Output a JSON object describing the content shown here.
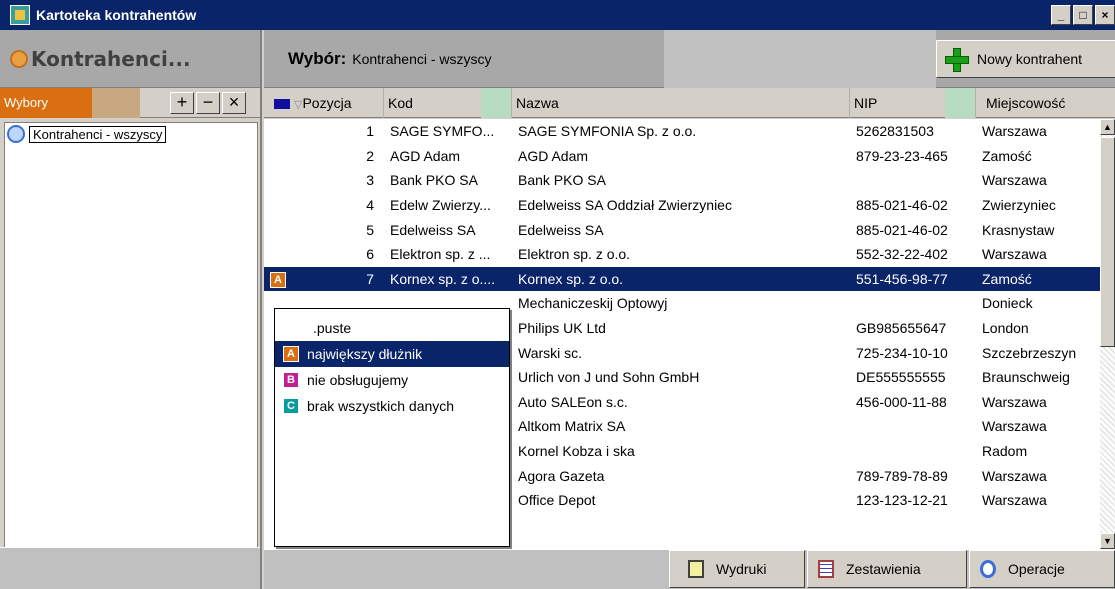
{
  "window": {
    "title": "Kartoteka kontrahentów"
  },
  "left": {
    "header": "Kontrahenci...",
    "wybory_tab": "Wybory",
    "tree_items": [
      "Kontrahenci - wszyscy"
    ]
  },
  "right": {
    "wybor_label": "Wybór:",
    "wybor_value": "Kontrahenci - wszyscy",
    "new_button": "Nowy kontrahent"
  },
  "columns": {
    "pozycja": "Pozycja",
    "kod": "Kod",
    "nazwa": "Nazwa",
    "nip": "NIP",
    "miejscowosc": "Miejscowość"
  },
  "rows": [
    {
      "mark": "",
      "poz": "1",
      "kod": "SAGE SYMFO...",
      "nazwa": "SAGE SYMFONIA Sp. z o.o.",
      "nip": "5262831503",
      "miasto": "Warszawa"
    },
    {
      "mark": "",
      "poz": "2",
      "kod": "AGD Adam",
      "nazwa": "AGD Adam",
      "nip": "879-23-23-465",
      "miasto": "Zamość"
    },
    {
      "mark": "",
      "poz": "3",
      "kod": "Bank PKO SA",
      "nazwa": "Bank PKO SA",
      "nip": "",
      "miasto": "Warszawa"
    },
    {
      "mark": "",
      "poz": "4",
      "kod": "Edelw Zwierzy...",
      "nazwa": "Edelweiss SA Oddział Zwierzyniec",
      "nip": "885-021-46-02",
      "miasto": "Zwierzyniec"
    },
    {
      "mark": "",
      "poz": "5",
      "kod": "Edelweiss SA",
      "nazwa": "Edelweiss SA",
      "nip": "885-021-46-02",
      "miasto": "Krasnystaw"
    },
    {
      "mark": "",
      "poz": "6",
      "kod": "Elektron sp. z ...",
      "nazwa": "Elektron sp. z o.o.",
      "nip": "552-32-22-402",
      "miasto": "Warszawa"
    },
    {
      "mark": "A",
      "poz": "7",
      "kod": "Kornex sp. z o....",
      "nazwa": "Kornex sp. z o.o.",
      "nip": "551-456-98-77",
      "miasto": "Zamość"
    },
    {
      "mark": "",
      "poz": "",
      "kod": "",
      "nazwa": "Mechaniczeskij Optowyj",
      "nip": "",
      "miasto": "Donieck"
    },
    {
      "mark": "",
      "poz": "",
      "kod": "",
      "nazwa": "Philips UK Ltd",
      "nip": "GB985655647",
      "miasto": "London"
    },
    {
      "mark": "",
      "poz": "",
      "kod": "",
      "nazwa": "Warski sc.",
      "nip": "725-234-10-10",
      "miasto": "Szczebrzeszyn"
    },
    {
      "mark": "",
      "poz": "",
      "kod": "",
      "nazwa": "Urlich von J und Sohn GmbH",
      "nip": "DE555555555",
      "miasto": "Braunschweig"
    },
    {
      "mark": "",
      "poz": "",
      "kod": "",
      "nazwa": "Auto SALEon s.c.",
      "nip": "456-000-11-88",
      "miasto": "Warszawa"
    },
    {
      "mark": "",
      "poz": "",
      "kod": "",
      "nazwa": "Altkom Matrix SA",
      "nip": "",
      "miasto": "Warszawa"
    },
    {
      "mark": "",
      "poz": "",
      "kod": "",
      "nazwa": "Kornel Kobza i ska",
      "nip": "",
      "miasto": "Radom"
    },
    {
      "mark": "",
      "poz": "",
      "kod": "",
      "nazwa": "Agora Gazeta",
      "nip": "789-789-78-89",
      "miasto": "Warszawa"
    },
    {
      "mark": "",
      "poz": "",
      "kod": "",
      "nazwa": "Office Depot",
      "nip": "123-123-12-21",
      "miasto": "Warszawa"
    }
  ],
  "popup": {
    "items": [
      {
        "badge": "",
        "label": ".puste"
      },
      {
        "badge": "A",
        "label": "największy dłużnik"
      },
      {
        "badge": "B",
        "label": "nie obsługujemy"
      },
      {
        "badge": "C",
        "label": "brak wszystkich danych"
      }
    ]
  },
  "bottom": {
    "wydruki": "Wydruki",
    "zestawienia": "Zestawienia",
    "operacje": "Operacje"
  },
  "colors": {
    "title_bar": "#0a246a",
    "selection": "#0a246a",
    "wybory_tab": "#d96f10",
    "badge_a": "#d96f10",
    "badge_b": "#c02090",
    "badge_c": "#0a9ba0"
  }
}
